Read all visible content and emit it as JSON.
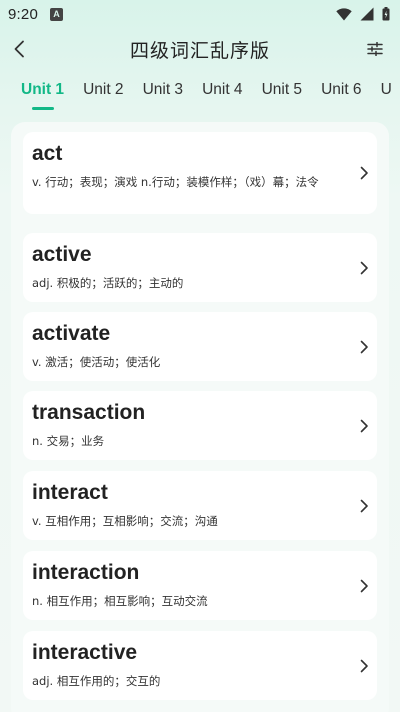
{
  "status_bar": {
    "time": "9:20",
    "notification_glyph": "A",
    "icons": [
      "wifi-icon",
      "signal-icon",
      "battery-icon"
    ]
  },
  "header": {
    "title": "四级词汇乱序版",
    "left_icon": "back-arrow-icon",
    "right_icon": "sliders-icon"
  },
  "tabs": [
    {
      "label": "Unit 1",
      "active": true
    },
    {
      "label": "Unit 2",
      "active": false
    },
    {
      "label": "Unit 3",
      "active": false
    },
    {
      "label": "Unit 4",
      "active": false
    },
    {
      "label": "Unit 5",
      "active": false
    },
    {
      "label": "Unit 6",
      "active": false
    },
    {
      "label": "U",
      "active": false
    }
  ],
  "words": [
    {
      "word": "act",
      "meaning": "v. 行动；表现；演戏 n.行动；装模作样；（戏）幕；法令"
    },
    {
      "word": "active",
      "meaning": "adj. 积极的；活跃的；主动的"
    },
    {
      "word": "activate",
      "meaning": "v. 激活；使活动；使活化"
    },
    {
      "word": "transaction",
      "meaning": "n. 交易；业务"
    },
    {
      "word": "interact",
      "meaning": "v. 互相作用；互相影响；交流；沟通"
    },
    {
      "word": "interaction",
      "meaning": "n. 相互作用；相互影响；互动交流"
    },
    {
      "word": "interactive",
      "meaning": "adj. 相互作用的；交互的"
    }
  ],
  "colors": {
    "accent": "#12b887",
    "background_top": "#d8f3ea",
    "card": "#ffffff",
    "text": "#222222"
  }
}
